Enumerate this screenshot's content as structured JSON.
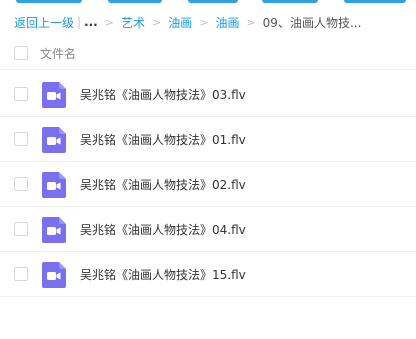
{
  "breadcrumb": {
    "back_label": "返回上一级",
    "ellipsis": "...",
    "items": [
      "艺术",
      "油画",
      "油画"
    ],
    "current": "09、油画人物技..."
  },
  "header": {
    "name_label": "文件名"
  },
  "files": [
    {
      "name": "吴兆铭《油画人物技法》03.flv",
      "icon": "video-icon"
    },
    {
      "name": "吴兆铭《油画人物技法》01.flv",
      "icon": "video-icon"
    },
    {
      "name": "吴兆铭《油画人物技法》02.flv",
      "icon": "video-icon"
    },
    {
      "name": "吴兆铭《油画人物技法》04.flv",
      "icon": "video-icon"
    },
    {
      "name": "吴兆铭《油画人物技法》15.flv",
      "icon": "video-icon"
    }
  ],
  "colors": {
    "accent": "#2ea0e6",
    "link": "#1e9be8",
    "video_icon": "#7a6ff0"
  }
}
